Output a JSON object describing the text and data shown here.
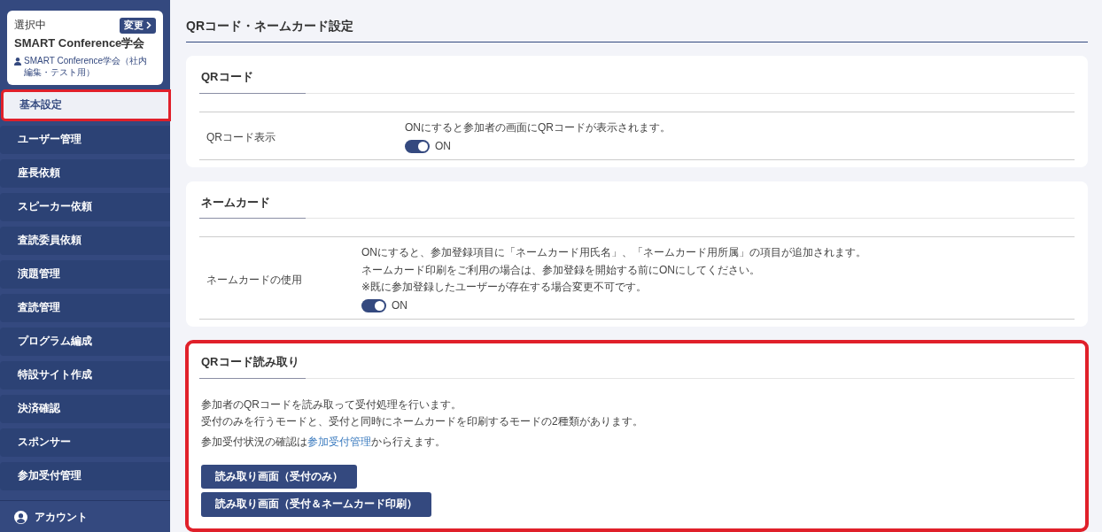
{
  "org_card": {
    "label": "選択中",
    "change_button": "変更",
    "name": "SMART Conference学会",
    "sub": "SMART Conference学会（社内編集・テスト用）"
  },
  "sidebar": {
    "items": [
      {
        "label": "基本設定",
        "selected": true,
        "highlighted": true
      },
      {
        "label": "ユーザー管理",
        "selected": false,
        "highlighted": false
      },
      {
        "label": "座長依頼",
        "selected": false,
        "highlighted": false
      },
      {
        "label": "スピーカー依頼",
        "selected": false,
        "highlighted": false
      },
      {
        "label": "査読委員依頼",
        "selected": false,
        "highlighted": false
      },
      {
        "label": "演題管理",
        "selected": false,
        "highlighted": false
      },
      {
        "label": "査読管理",
        "selected": false,
        "highlighted": false
      },
      {
        "label": "プログラム編成",
        "selected": false,
        "highlighted": false
      },
      {
        "label": "特設サイト作成",
        "selected": false,
        "highlighted": false
      },
      {
        "label": "決済確認",
        "selected": false,
        "highlighted": false
      },
      {
        "label": "スポンサー",
        "selected": false,
        "highlighted": false
      },
      {
        "label": "参加受付管理",
        "selected": false,
        "highlighted": false
      }
    ],
    "account": "アカウント"
  },
  "page_title": "QRコード・ネームカード設定",
  "sections": [
    {
      "kind": "settings",
      "title": "QRコード",
      "highlighted": false,
      "rows": [
        {
          "label": "QRコード表示",
          "description": [
            "ONにすると参加者の画面にQRコードが表示されます。"
          ],
          "toggle": {
            "on": true,
            "label": "ON"
          }
        }
      ]
    },
    {
      "kind": "settings",
      "title": "ネームカード",
      "highlighted": false,
      "rows": [
        {
          "label": "ネームカードの使用",
          "description": [
            "ONにすると、参加登録項目に「ネームカード用氏名」、「ネームカード用所属」の項目が追加されます。",
            "ネームカード印刷をご利用の場合は、参加登録を開始する前にONにしてください。",
            "※既に参加登録したユーザーが存在する場合変更不可です。"
          ],
          "toggle": {
            "on": true,
            "label": "ON"
          }
        }
      ]
    },
    {
      "kind": "info",
      "title": "QRコード読み取り",
      "highlighted": true,
      "paragraphs": [
        "参加者のQRコードを読み取って受付処理を行います。",
        "受付のみを行うモードと、受付と同時にネームカードを印刷するモードの2種類があります。"
      ],
      "note": {
        "before": "参加受付状況の確認は",
        "link": "参加受付管理",
        "after": "から行えます。"
      },
      "buttons": [
        "読み取り画面（受付のみ）",
        "読み取り画面（受付＆ネームカード印刷）"
      ]
    }
  ]
}
